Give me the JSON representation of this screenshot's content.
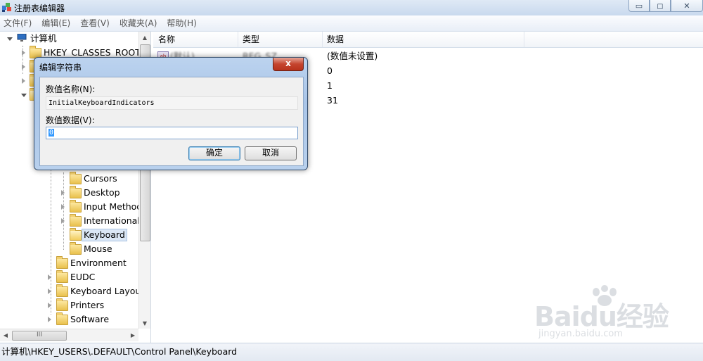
{
  "window": {
    "title": "注册表编辑器",
    "controls": {
      "minimize": "▭",
      "restore": "◻",
      "close": "✕"
    }
  },
  "menu": [
    "文件(F)",
    "编辑(E)",
    "查看(V)",
    "收藏夹(A)",
    "帮助(H)"
  ],
  "tree": {
    "root": "计算机",
    "items": [
      {
        "label": "HKEY_CLASSES_ROOT"
      },
      {
        "label": "Cursors"
      },
      {
        "label": "Desktop"
      },
      {
        "label": "Input Method"
      },
      {
        "label": "International"
      },
      {
        "label": "Keyboard",
        "selected": true
      },
      {
        "label": "Mouse"
      },
      {
        "label": "Environment"
      },
      {
        "label": "EUDC"
      },
      {
        "label": "Keyboard Layout"
      },
      {
        "label": "Printers"
      },
      {
        "label": "Software"
      }
    ],
    "hscroll_grip": "III"
  },
  "list": {
    "columns": [
      "名称",
      "类型",
      "数据"
    ],
    "rows": [
      {
        "name": "(默认)",
        "type": "REG_SZ",
        "data": "(数值未设置)"
      },
      {
        "name": "",
        "type": "",
        "data": "0"
      },
      {
        "name": "",
        "type": "",
        "data": "1"
      },
      {
        "name": "",
        "type": "",
        "data": "31"
      }
    ]
  },
  "dialog": {
    "title": "编辑字符串",
    "close": "x",
    "value_name_label": "数值名称(N):",
    "value_name": "InitialKeyboardIndicators",
    "value_data_label": "数值数据(V):",
    "value_data": "0",
    "ok": "确定",
    "cancel": "取消"
  },
  "statusbar": "计算机\\HKEY_USERS\\.DEFAULT\\Control Panel\\Keyboard",
  "watermark": {
    "brand": "Baidu经验",
    "url": "jingyan.baidu.com"
  }
}
